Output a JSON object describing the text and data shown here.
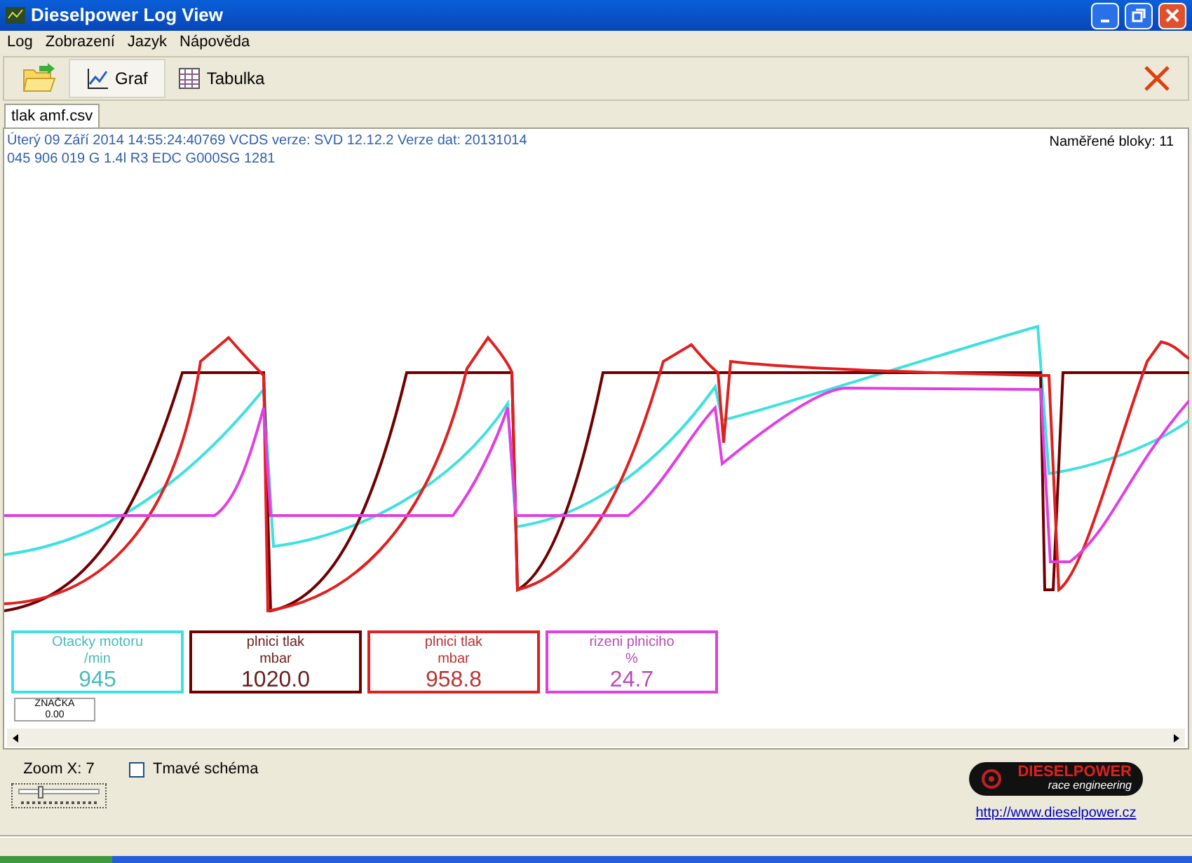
{
  "window": {
    "title": "Dieselpower Log View"
  },
  "menu": [
    {
      "label": "Log"
    },
    {
      "label": "Zobrazení"
    },
    {
      "label": "Jazyk"
    },
    {
      "label": "Nápověda"
    }
  ],
  "toolbar": [
    {
      "kind": "open"
    },
    {
      "kind": "graph",
      "label": "Graf",
      "selected": true
    },
    {
      "kind": "table",
      "label": "Tabulka",
      "selected": false
    }
  ],
  "file_tabs": [
    {
      "label": "tlak amf.csv",
      "selected": true
    }
  ],
  "info": {
    "line_1": "Úterý 09 Září 2014 14:55:24:40769 VCDS verze: SVD 12.12.2 Verze dat: 20131014",
    "line_2": "045 906 019 G  1.4l R3 EDC G000SG  1281",
    "blocks": "Naměřené bloky: 11"
  },
  "channels": [
    {
      "name": "Otacky motoru",
      "unit": "/min",
      "value": "945",
      "color": "#40e0e0"
    },
    {
      "name": "plnici tlak",
      "unit": "mbar",
      "value": "1020.0",
      "color": "#700000"
    },
    {
      "name": "plnici tlak",
      "unit": "mbar",
      "value": "958.8",
      "color": "#e02020"
    },
    {
      "name": "rizeni plniciho",
      "unit": "%",
      "value": "24.7",
      "color": "#e040e0"
    }
  ],
  "marker": {
    "label": "ZNAČKA",
    "value": "0.00"
  },
  "zoom": {
    "label": "Zoom X: 7",
    "level": 0.25
  },
  "dark_scheme": {
    "label": "Tmavé schéma",
    "checked": false
  },
  "logo": {
    "name": "DIESELPOWER",
    "tagline": "race engineering"
  },
  "link": "http://www.dieselpower.cz"
}
